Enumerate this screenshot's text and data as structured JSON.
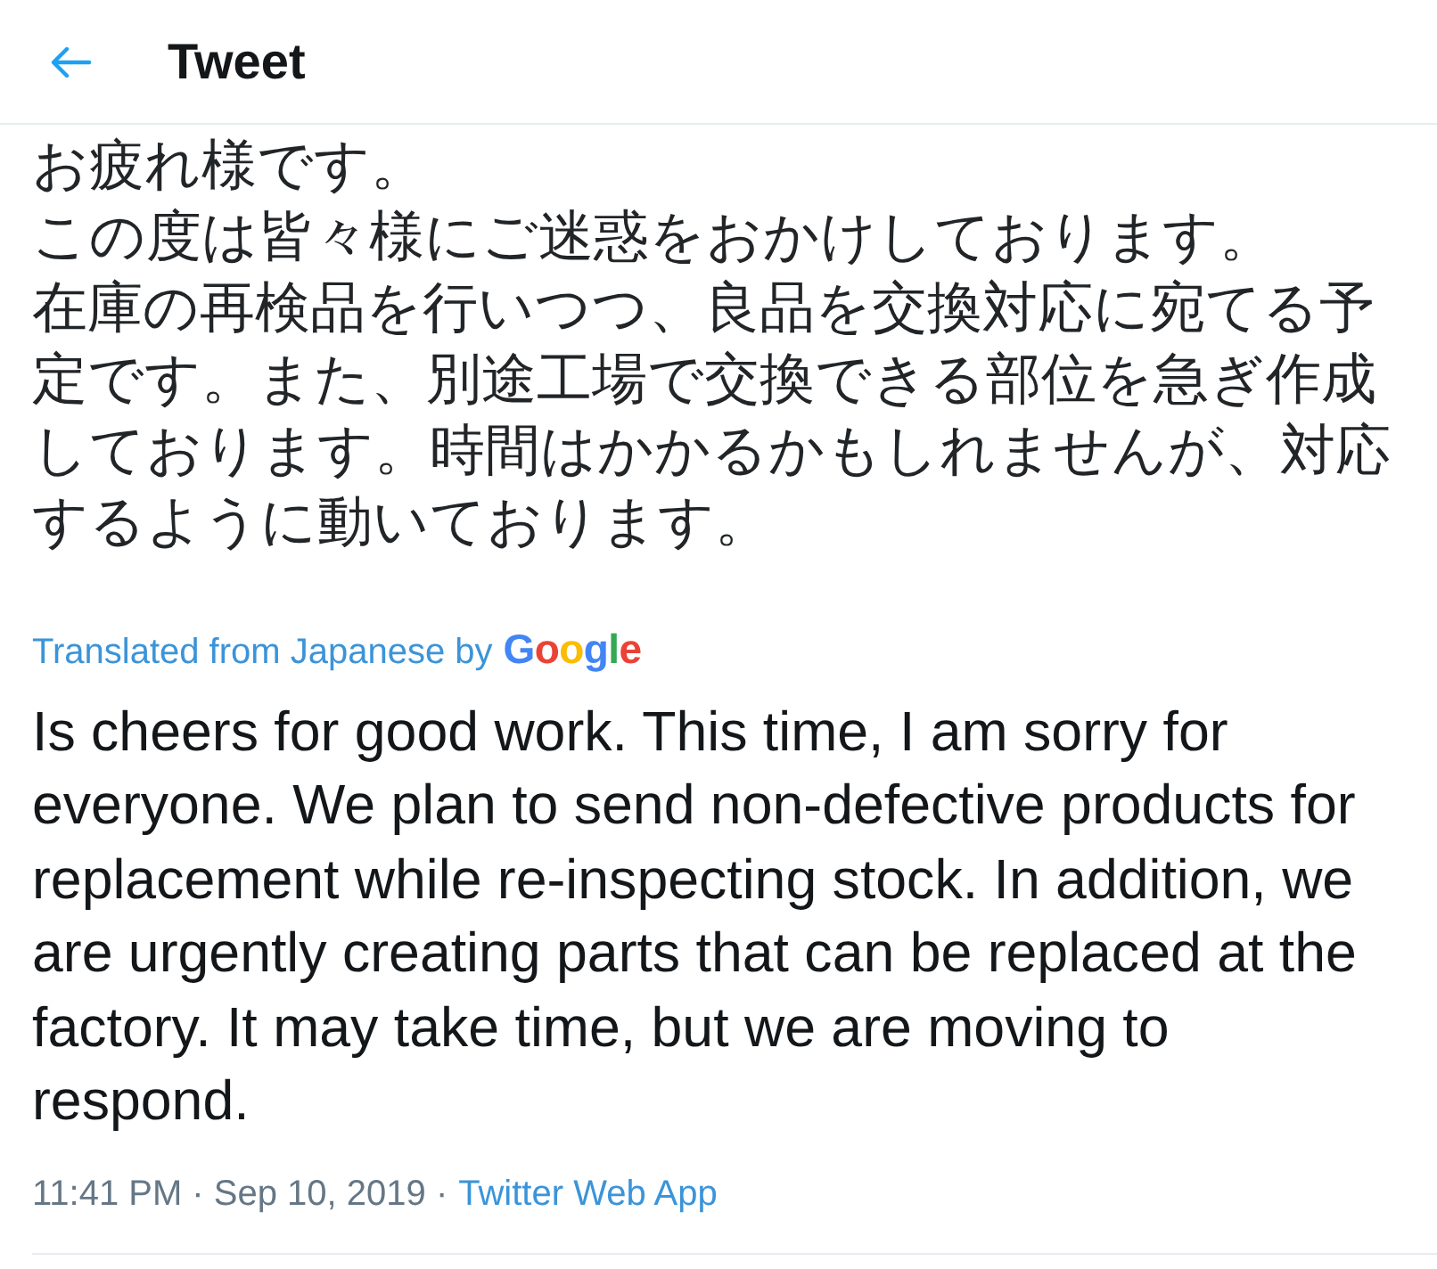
{
  "header": {
    "title": "Tweet"
  },
  "tweet": {
    "original_paragraphs": [
      "お疲れ様です。",
      "この度は皆々様にご迷惑をおかけしております。",
      "在庫の再検品を行いつつ、良品を交換対応に宛てる予定です。また、別途工場で交換できる部位を急ぎ作成しております。時間はかかるかもしれませんが、対応するように動いております。"
    ],
    "translation": {
      "credit": "Translated from Japanese by",
      "provider": "Google",
      "text": "Is cheers for good work. This time, I am sorry for everyone. We plan to send non-defective products for replacement while re-inspecting stock. In addition, we are urgently creating parts that can be replaced at the factory. It may take time, but we are moving to respond."
    },
    "timestamp": "11:41 PM · Sep 10, 2019 ·",
    "source": "Twitter Web App"
  }
}
